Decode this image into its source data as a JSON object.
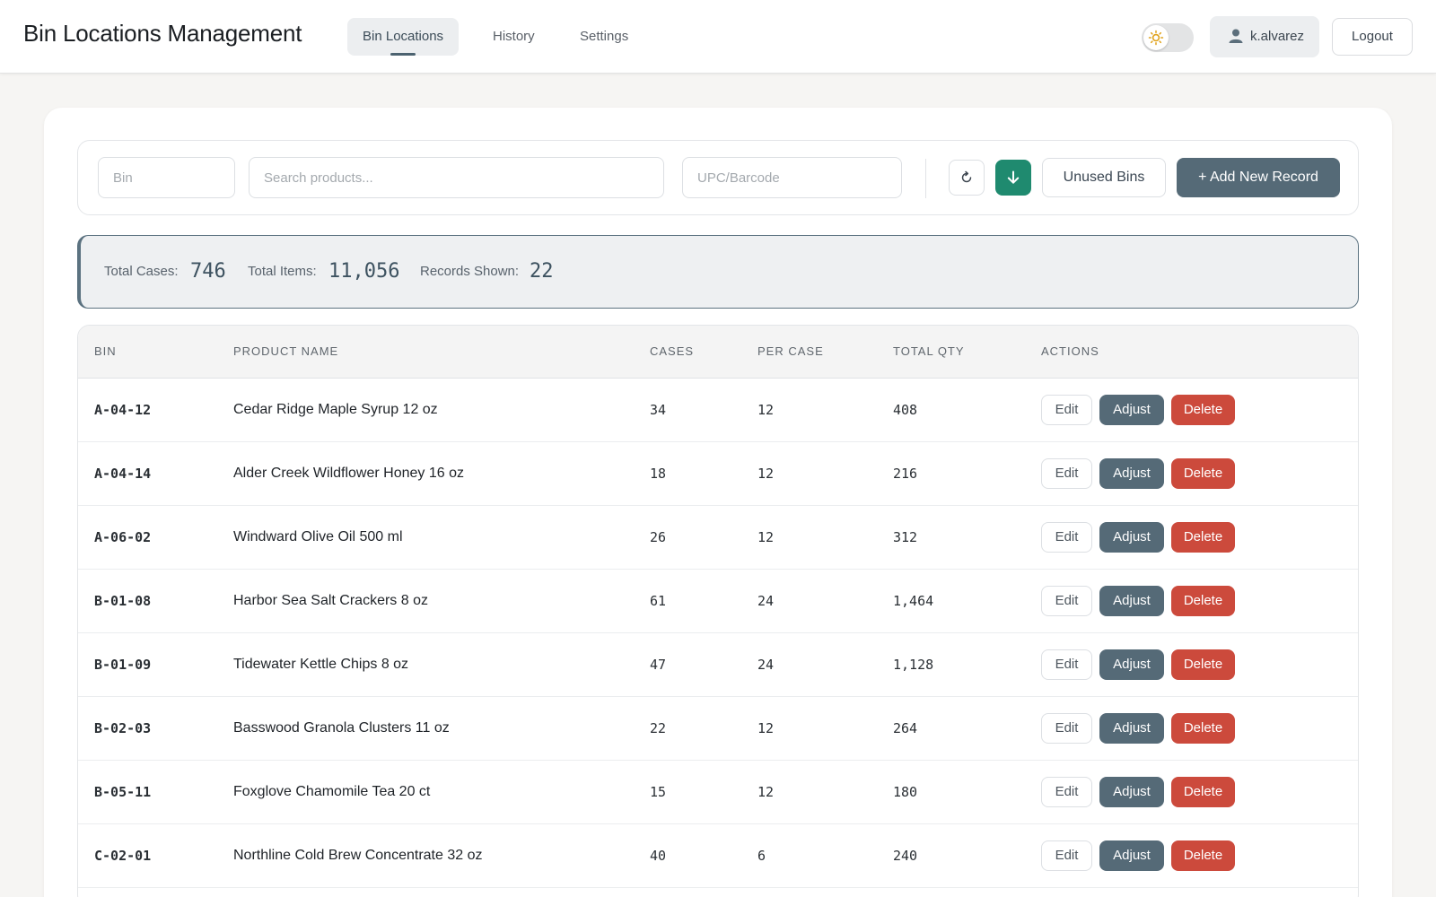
{
  "header": {
    "title": "Bin Locations Management",
    "tabs": [
      {
        "label": "Bin Locations",
        "active": true
      },
      {
        "label": "History",
        "active": false
      },
      {
        "label": "Settings",
        "active": false
      }
    ],
    "theme_icon": "sun-icon",
    "user": {
      "name": "k.alvarez",
      "icon": "user-icon"
    },
    "logout_label": "Logout"
  },
  "filters": {
    "bin_placeholder": "Bin",
    "search_placeholder": "Search products...",
    "upc_placeholder": "UPC/Barcode",
    "refresh_icon": "refresh-icon",
    "download_icon": "download-icon",
    "unused_bins_label": "Unused Bins",
    "add_record_label": "+ Add New Record"
  },
  "totals": {
    "cases_label": "Total Cases:",
    "cases_value": "746",
    "items_label": "Total Items:",
    "items_value": "11,056",
    "records_label": "Records Shown:",
    "records_value": "22"
  },
  "table": {
    "columns": [
      "BIN",
      "PRODUCT NAME",
      "CASES",
      "PER CASE",
      "TOTAL QTY",
      "ACTIONS"
    ],
    "action_labels": {
      "edit": "Edit",
      "adjust": "Adjust",
      "delete": "Delete"
    },
    "rows": [
      {
        "bin": "A-04-12",
        "product": "Cedar Ridge Maple Syrup 12 oz",
        "cases": "34",
        "per_case": "12",
        "total": "408"
      },
      {
        "bin": "A-04-14",
        "product": "Alder Creek Wildflower Honey 16 oz",
        "cases": "18",
        "per_case": "12",
        "total": "216"
      },
      {
        "bin": "A-06-02",
        "product": "Windward Olive Oil 500 ml",
        "cases": "26",
        "per_case": "12",
        "total": "312"
      },
      {
        "bin": "B-01-08",
        "product": "Harbor Sea Salt Crackers 8 oz",
        "cases": "61",
        "per_case": "24",
        "total": "1,464"
      },
      {
        "bin": "B-01-09",
        "product": "Tidewater Kettle Chips 8 oz",
        "cases": "47",
        "per_case": "24",
        "total": "1,128"
      },
      {
        "bin": "B-02-03",
        "product": "Basswood Granola Clusters 11 oz",
        "cases": "22",
        "per_case": "12",
        "total": "264"
      },
      {
        "bin": "B-05-11",
        "product": "Foxglove Chamomile Tea 20 ct",
        "cases": "15",
        "per_case": "12",
        "total": "180"
      },
      {
        "bin": "C-02-01",
        "product": "Northline Cold Brew Concentrate 32 oz",
        "cases": "40",
        "per_case": "6",
        "total": "240"
      }
    ]
  },
  "colors": {
    "accent": "#556a77",
    "download": "#1f8a6f",
    "danger": "#cc4a3c"
  }
}
